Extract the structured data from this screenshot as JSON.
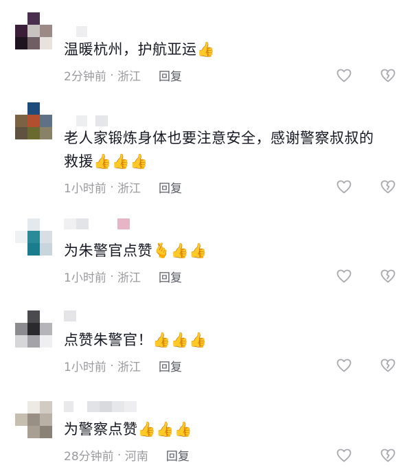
{
  "comments": [
    {
      "text": "温暖杭州，护航亚运👍",
      "time": "2分钟前",
      "location": "浙江",
      "reply_label": "回复"
    },
    {
      "text": "老人家锻炼身体也要注意安全，感谢警察叔叔的救援👍👍👍",
      "time": "1小时前",
      "location": "浙江",
      "reply_label": "回复"
    },
    {
      "text": "为朱警官点赞🫰👍👍",
      "time": "1小时前",
      "location": "浙江",
      "reply_label": "回复"
    },
    {
      "text": "点赞朱警官！👍👍👍",
      "time": "1小时前",
      "location": "浙江",
      "reply_label": "回复"
    },
    {
      "text": "为警察点赞👍👍👍",
      "time": "28分钟前",
      "location": "河南",
      "reply_label": "回复"
    }
  ],
  "icons": {
    "like": "heart-outline-icon",
    "dislike": "broken-heart-outline-icon"
  },
  "colors": {
    "text": "#161823",
    "meta": "#9a9a9e",
    "reply": "#5a5c66",
    "icon": "#a8a8ae"
  }
}
